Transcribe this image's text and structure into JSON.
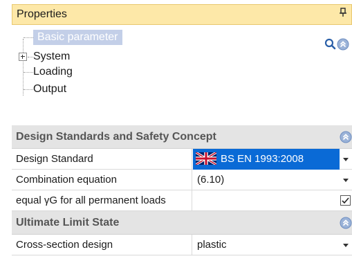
{
  "panel": {
    "title": "Properties",
    "pin_glyph": "❠"
  },
  "tree": {
    "items": [
      {
        "label": "Basic parameter",
        "selected": true,
        "expandable": false
      },
      {
        "label": "System",
        "selected": false,
        "expandable": true
      },
      {
        "label": "Loading",
        "selected": false,
        "expandable": false
      },
      {
        "label": "Output",
        "selected": false,
        "expandable": false
      }
    ],
    "search_icon": "search-icon",
    "collapse_icon": "chevron-up-circle-icon"
  },
  "sections": [
    {
      "title": "Design Standards and Safety Concept",
      "rows": [
        {
          "name": "Design Standard",
          "value": "BS EN 1993:2008",
          "control": "dropdown",
          "selected": true,
          "flag": "uk-flag-icon"
        },
        {
          "name": "Combination equation",
          "value": "(6.10)",
          "control": "dropdown",
          "selected": false
        },
        {
          "name": "equal γG for all permanent loads",
          "value": "",
          "control": "checkbox",
          "checked": true
        }
      ]
    },
    {
      "title": "Ultimate Limit State",
      "rows": [
        {
          "name": "Cross-section design",
          "value": "plastic",
          "control": "dropdown",
          "selected": false
        }
      ]
    }
  ],
  "colors": {
    "title_bg": "#fde8a8",
    "selection": "#0a6ad6",
    "tree_selection": "#c3cfe8",
    "section_bg": "#e4e4e4"
  }
}
